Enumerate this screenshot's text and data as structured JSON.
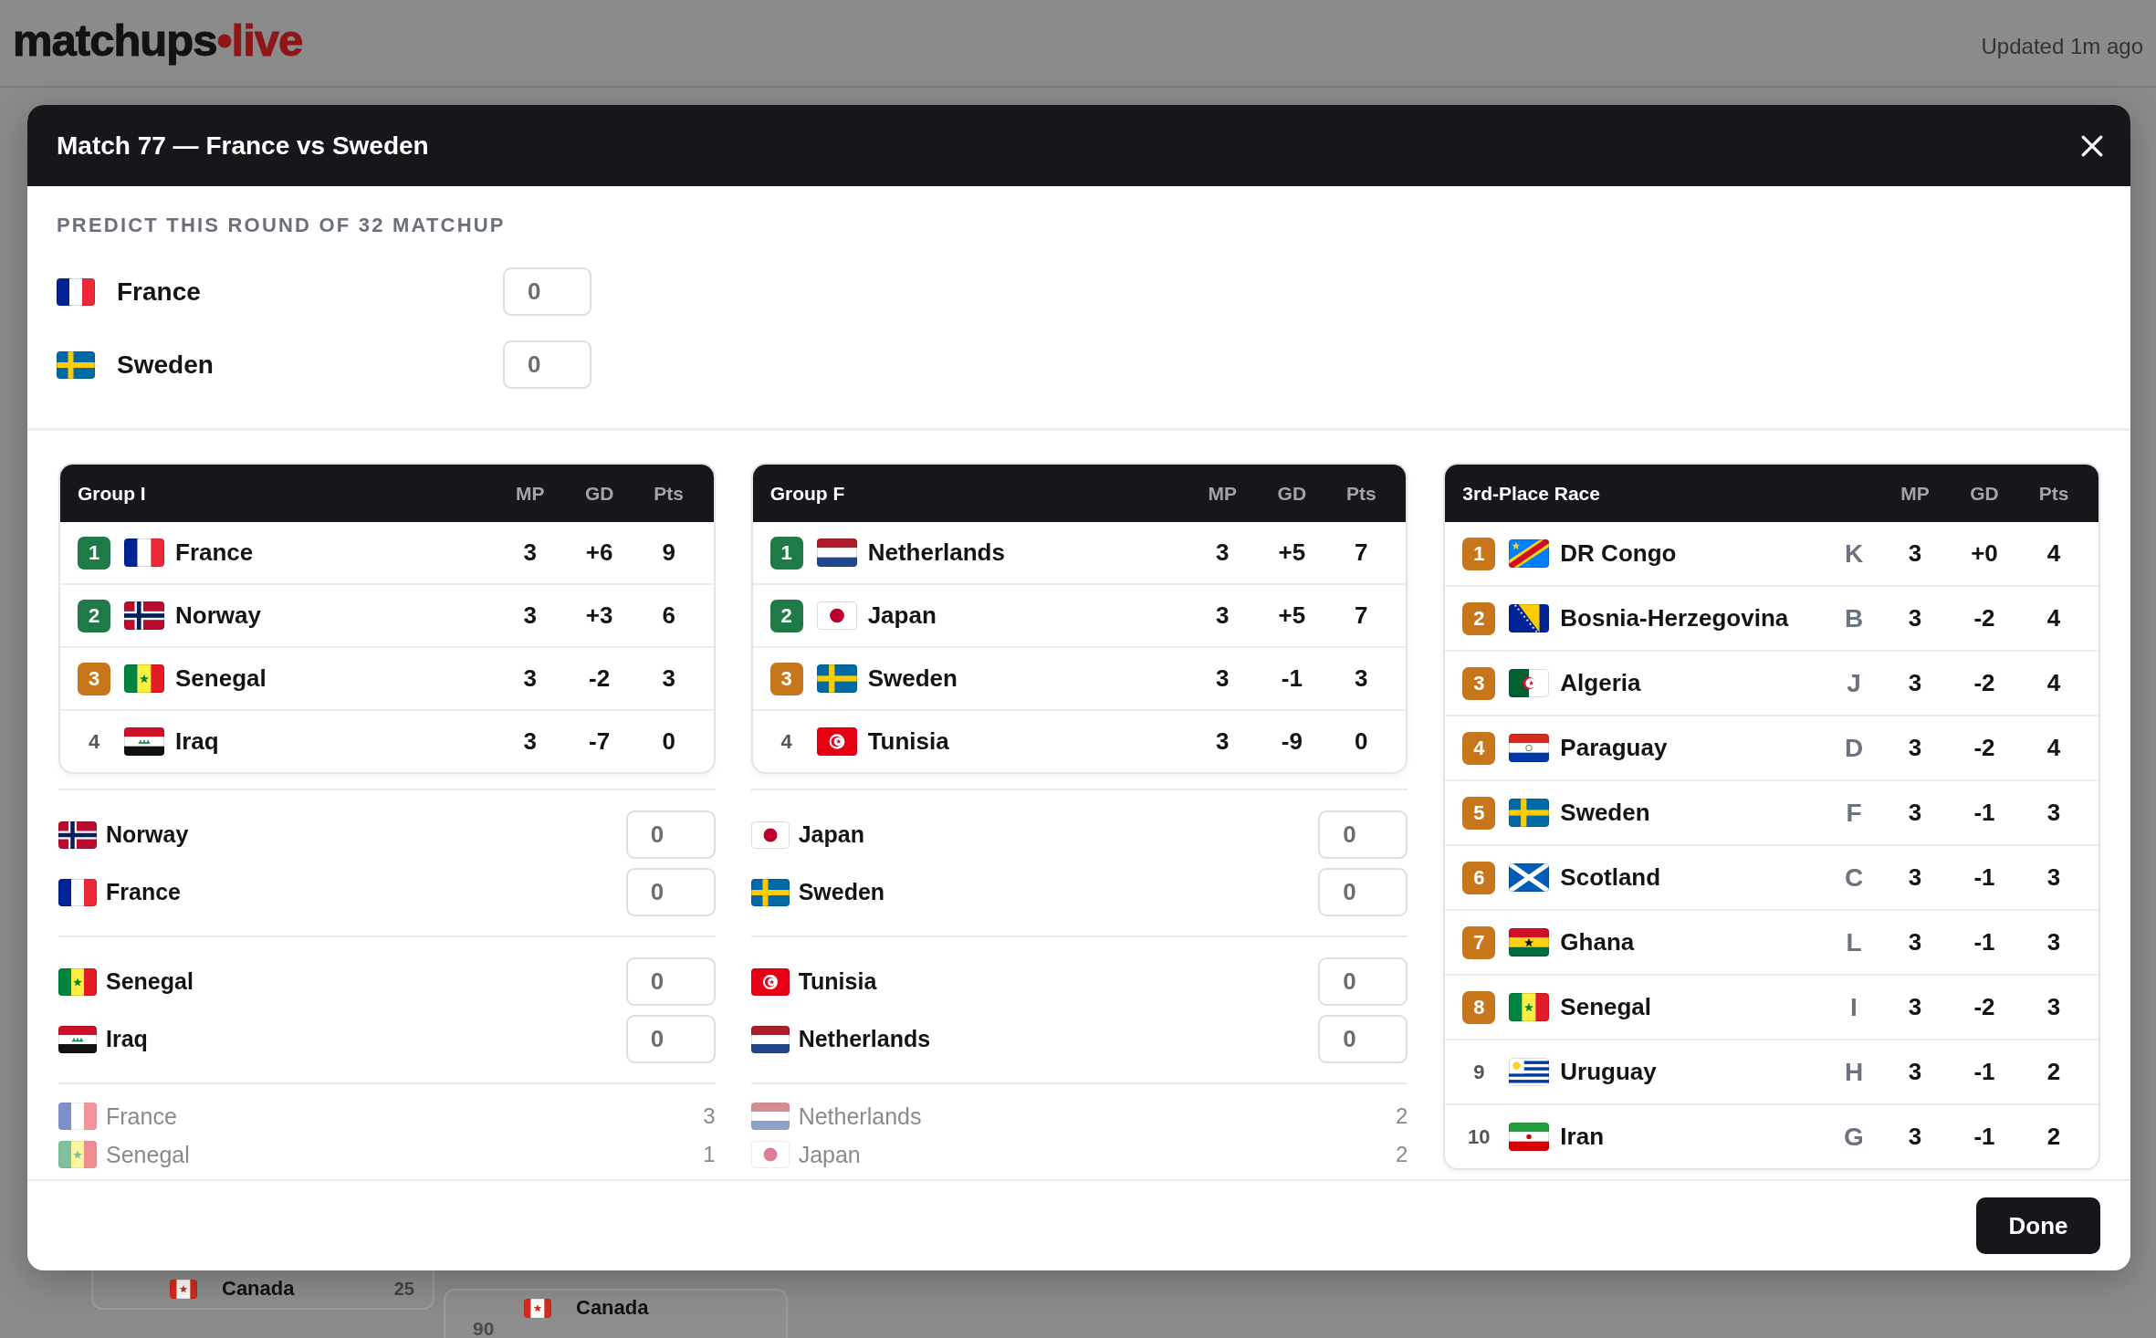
{
  "page": {
    "logo": {
      "text": "matchups",
      "accent": "•live"
    },
    "updated": "Updated 1m ago",
    "background_cards": [
      {
        "kind": "ca",
        "team": "Canada",
        "value": "25"
      },
      {
        "kind": "ca",
        "team": "Canada",
        "value": "90"
      }
    ]
  },
  "modal": {
    "title": "Match 77 — France vs Sweden",
    "prediction": {
      "heading": "PREDICT THIS ROUND OF 32 MATCHUP",
      "teams": [
        {
          "kind": "fr",
          "name": "France",
          "score": "0"
        },
        {
          "kind": "se",
          "name": "Sweden",
          "score": "0"
        }
      ]
    },
    "groups": [
      {
        "title": "Group I",
        "columns": [
          "MP",
          "GD",
          "Pts"
        ],
        "rows": [
          {
            "rank": "1",
            "color": "#1e7b47",
            "kind": "fr",
            "team": "France",
            "mp": "3",
            "gd": "+6",
            "pts": "9"
          },
          {
            "rank": "2",
            "color": "#1e7b47",
            "kind": "no",
            "team": "Norway",
            "mp": "3",
            "gd": "+3",
            "pts": "6"
          },
          {
            "rank": "3",
            "color": "#c7761c",
            "kind": "sn",
            "team": "Senegal",
            "mp": "3",
            "gd": "-2",
            "pts": "3"
          },
          {
            "rank": "4",
            "kind": "iq",
            "team": "Iraq",
            "mp": "3",
            "gd": "-7",
            "pts": "0"
          }
        ],
        "matches": [
          {
            "kind": "prediction",
            "teams": [
              {
                "kind": "no",
                "name": "Norway",
                "score": "0"
              },
              {
                "kind": "fr",
                "name": "France",
                "score": "0"
              }
            ]
          },
          {
            "kind": "prediction",
            "teams": [
              {
                "kind": "sn",
                "name": "Senegal",
                "score": "0"
              },
              {
                "kind": "iq",
                "name": "Iraq",
                "score": "0"
              }
            ]
          },
          {
            "kind": "result",
            "teams": [
              {
                "kind": "fr",
                "name": "France",
                "score": "3"
              },
              {
                "kind": "sn",
                "name": "Senegal",
                "score": "1"
              }
            ]
          }
        ]
      },
      {
        "title": "Group F",
        "columns": [
          "MP",
          "GD",
          "Pts"
        ],
        "rows": [
          {
            "rank": "1",
            "color": "#1e7b47",
            "kind": "nl",
            "team": "Netherlands",
            "mp": "3",
            "gd": "+5",
            "pts": "7"
          },
          {
            "rank": "2",
            "color": "#1e7b47",
            "kind": "jp",
            "team": "Japan",
            "mp": "3",
            "gd": "+5",
            "pts": "7"
          },
          {
            "rank": "3",
            "color": "#c7761c",
            "kind": "se",
            "team": "Sweden",
            "mp": "3",
            "gd": "-1",
            "pts": "3"
          },
          {
            "rank": "4",
            "kind": "tn",
            "team": "Tunisia",
            "mp": "3",
            "gd": "-9",
            "pts": "0"
          }
        ],
        "matches": [
          {
            "kind": "prediction",
            "teams": [
              {
                "kind": "jp",
                "name": "Japan",
                "score": "0"
              },
              {
                "kind": "se",
                "name": "Sweden",
                "score": "0"
              }
            ]
          },
          {
            "kind": "prediction",
            "teams": [
              {
                "kind": "tn",
                "name": "Tunisia",
                "score": "0"
              },
              {
                "kind": "nl",
                "name": "Netherlands",
                "score": "0"
              }
            ]
          },
          {
            "kind": "result",
            "teams": [
              {
                "kind": "nl",
                "name": "Netherlands",
                "score": "2"
              },
              {
                "kind": "jp",
                "name": "Japan",
                "score": "2"
              }
            ]
          }
        ]
      }
    ],
    "third_place": {
      "title": "3rd-Place Race",
      "columns": [
        "MP",
        "GD",
        "Pts"
      ],
      "rows": [
        {
          "rank": "1",
          "color": "#c7761c",
          "kind": "cd",
          "team": "DR Congo",
          "group": "K",
          "mp": "3",
          "gd": "+0",
          "pts": "4"
        },
        {
          "rank": "2",
          "color": "#c7761c",
          "kind": "ba",
          "team": "Bosnia-Herzegovina",
          "group": "B",
          "mp": "3",
          "gd": "-2",
          "pts": "4"
        },
        {
          "rank": "3",
          "color": "#c7761c",
          "kind": "dz",
          "team": "Algeria",
          "group": "J",
          "mp": "3",
          "gd": "-2",
          "pts": "4"
        },
        {
          "rank": "4",
          "color": "#c7761c",
          "kind": "py",
          "team": "Paraguay",
          "group": "D",
          "mp": "3",
          "gd": "-2",
          "pts": "4"
        },
        {
          "rank": "5",
          "color": "#c7761c",
          "kind": "se",
          "team": "Sweden",
          "group": "F",
          "mp": "3",
          "gd": "-1",
          "pts": "3"
        },
        {
          "rank": "6",
          "color": "#c7761c",
          "kind": "sct",
          "team": "Scotland",
          "group": "C",
          "mp": "3",
          "gd": "-1",
          "pts": "3"
        },
        {
          "rank": "7",
          "color": "#c7761c",
          "kind": "gh",
          "team": "Ghana",
          "group": "L",
          "mp": "3",
          "gd": "-1",
          "pts": "3"
        },
        {
          "rank": "8",
          "color": "#c7761c",
          "kind": "sn",
          "team": "Senegal",
          "group": "I",
          "mp": "3",
          "gd": "-2",
          "pts": "3"
        },
        {
          "rank": "9",
          "kind": "uy",
          "team": "Uruguay",
          "group": "H",
          "mp": "3",
          "gd": "-1",
          "pts": "2"
        },
        {
          "rank": "10",
          "kind": "ir",
          "team": "Iran",
          "group": "G",
          "mp": "3",
          "gd": "-1",
          "pts": "2"
        }
      ]
    },
    "footer": {
      "button": "Done"
    }
  }
}
